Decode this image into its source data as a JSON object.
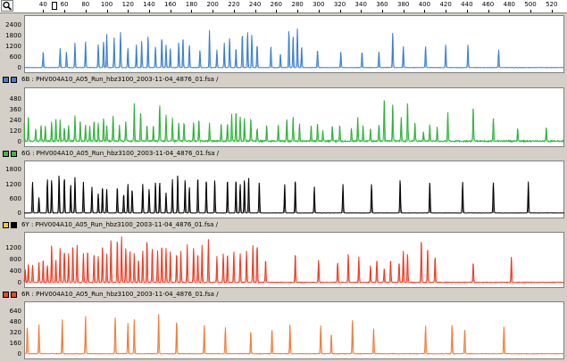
{
  "ruler": {
    "ticks": [
      "40",
      "60",
      "80",
      "100",
      "120",
      "140",
      "160",
      "180",
      "200",
      "220",
      "240",
      "260",
      "280",
      "300",
      "320",
      "340",
      "360",
      "380",
      "400",
      "420",
      "440",
      "460",
      "480",
      "500",
      "520"
    ],
    "x_range": [
      22,
      532
    ]
  },
  "panels": [
    {
      "name": "blue",
      "color": "#3a7fd0",
      "header_label": "",
      "header_squares": [],
      "y_labels": [
        "2400",
        "1800",
        "1200",
        "600",
        "0"
      ],
      "ymax": 2700,
      "noise": 20,
      "peaks": [
        [
          40,
          900
        ],
        [
          56,
          1100
        ],
        [
          62,
          900
        ],
        [
          70,
          1400
        ],
        [
          80,
          1500
        ],
        [
          92,
          1300
        ],
        [
          97,
          1500
        ],
        [
          100,
          1900
        ],
        [
          107,
          1700
        ],
        [
          113,
          2000
        ],
        [
          120,
          1100
        ],
        [
          128,
          1300
        ],
        [
          133,
          1500
        ],
        [
          139,
          1800
        ],
        [
          146,
          1200
        ],
        [
          152,
          1700
        ],
        [
          156,
          1300
        ],
        [
          160,
          1100
        ],
        [
          168,
          1400
        ],
        [
          172,
          1700
        ],
        [
          178,
          1300
        ],
        [
          188,
          1000
        ],
        [
          197,
          2100
        ],
        [
          204,
          1000
        ],
        [
          211,
          1400
        ],
        [
          216,
          1700
        ],
        [
          222,
          1100
        ],
        [
          228,
          1900
        ],
        [
          233,
          2000
        ],
        [
          237,
          1900
        ],
        [
          242,
          1300
        ],
        [
          255,
          1200
        ],
        [
          264,
          800
        ],
        [
          272,
          2100
        ],
        [
          276,
          1800
        ],
        [
          280,
          2200
        ],
        [
          284,
          1200
        ],
        [
          299,
          1000
        ],
        [
          321,
          900
        ],
        [
          341,
          900
        ],
        [
          357,
          900
        ],
        [
          370,
          2000
        ],
        [
          380,
          1200
        ],
        [
          401,
          1200
        ],
        [
          420,
          1300
        ],
        [
          441,
          1300
        ],
        [
          470,
          1000
        ]
      ]
    },
    {
      "name": "green",
      "color": "#2fb33a",
      "header_label": "6B : PHV004A10_A05_Run_hbz3100_2003-11-04_4876_01.fsa /",
      "header_squares": [
        "#4a7fc8",
        "#4a7fc8"
      ],
      "y_labels": [
        "480",
        "360",
        "240",
        "120",
        "0"
      ],
      "ymax": 560,
      "noise": 15,
      "peaks": [
        [
          22,
          210
        ],
        [
          26,
          280
        ],
        [
          33,
          150
        ],
        [
          38,
          190
        ],
        [
          42,
          170
        ],
        [
          48,
          220
        ],
        [
          52,
          260
        ],
        [
          56,
          240
        ],
        [
          60,
          150
        ],
        [
          64,
          180
        ],
        [
          70,
          290
        ],
        [
          75,
          240
        ],
        [
          80,
          190
        ],
        [
          84,
          170
        ],
        [
          88,
          230
        ],
        [
          92,
          200
        ],
        [
          97,
          260
        ],
        [
          100,
          180
        ],
        [
          106,
          290
        ],
        [
          112,
          180
        ],
        [
          118,
          220
        ],
        [
          126,
          420
        ],
        [
          132,
          330
        ],
        [
          138,
          180
        ],
        [
          144,
          180
        ],
        [
          150,
          420
        ],
        [
          156,
          300
        ],
        [
          162,
          260
        ],
        [
          168,
          200
        ],
        [
          173,
          210
        ],
        [
          182,
          210
        ],
        [
          187,
          250
        ],
        [
          197,
          200
        ],
        [
          208,
          200
        ],
        [
          214,
          200
        ],
        [
          218,
          300
        ],
        [
          222,
          340
        ],
        [
          226,
          280
        ],
        [
          230,
          260
        ],
        [
          236,
          260
        ],
        [
          242,
          150
        ],
        [
          251,
          180
        ],
        [
          262,
          190
        ],
        [
          270,
          260
        ],
        [
          276,
          280
        ],
        [
          282,
          200
        ],
        [
          293,
          180
        ],
        [
          299,
          200
        ],
        [
          304,
          120
        ],
        [
          313,
          180
        ],
        [
          320,
          180
        ],
        [
          331,
          150
        ],
        [
          337,
          270
        ],
        [
          342,
          180
        ],
        [
          349,
          150
        ],
        [
          357,
          190
        ],
        [
          362,
          500
        ],
        [
          370,
          420
        ],
        [
          378,
          270
        ],
        [
          384,
          440
        ],
        [
          391,
          210
        ],
        [
          399,
          100
        ],
        [
          405,
          190
        ],
        [
          412,
          160
        ],
        [
          422,
          320
        ],
        [
          446,
          400
        ],
        [
          465,
          270
        ],
        [
          488,
          150
        ],
        [
          515,
          160
        ]
      ]
    },
    {
      "name": "yellow",
      "color": "#000000",
      "header_label": "6G : PHV004A10_A05_Run_hbz3100_2003-11-04_4876_01.fsa /",
      "header_squares": [
        "#3db84a",
        "#3db84a"
      ],
      "y_labels": [
        "1800",
        "1200",
        "600",
        "0"
      ],
      "ymax": 2000,
      "noise": 10,
      "peaks": [
        [
          30,
          1300
        ],
        [
          36,
          650
        ],
        [
          44,
          1400
        ],
        [
          48,
          1400
        ],
        [
          55,
          1600
        ],
        [
          60,
          1500
        ],
        [
          66,
          1200
        ],
        [
          70,
          1500
        ],
        [
          78,
          1300
        ],
        [
          86,
          1100
        ],
        [
          92,
          800
        ],
        [
          96,
          1100
        ],
        [
          100,
          1000
        ],
        [
          110,
          1100
        ],
        [
          116,
          800
        ],
        [
          120,
          1200
        ],
        [
          124,
          1000
        ],
        [
          134,
          1200
        ],
        [
          140,
          1000
        ],
        [
          146,
          1300
        ],
        [
          150,
          1300
        ],
        [
          156,
          850
        ],
        [
          162,
          1400
        ],
        [
          167,
          1600
        ],
        [
          174,
          1400
        ],
        [
          178,
          1100
        ],
        [
          186,
          1500
        ],
        [
          194,
          1400
        ],
        [
          202,
          1400
        ],
        [
          214,
          1400
        ],
        [
          222,
          1400
        ],
        [
          226,
          1200
        ],
        [
          230,
          1400
        ],
        [
          234,
          1500
        ],
        [
          244,
          1300
        ],
        [
          268,
          1200
        ],
        [
          278,
          1400
        ],
        [
          296,
          1100
        ],
        [
          323,
          1200
        ],
        [
          350,
          1200
        ],
        [
          377,
          1400
        ],
        [
          405,
          1300
        ],
        [
          436,
          1300
        ],
        [
          465,
          1300
        ],
        [
          498,
          1300
        ]
      ]
    },
    {
      "name": "red",
      "color": "#ee3b22",
      "header_label": "6Y : PHV004A10_A05_Run_hbz3100_2003-11-04_4876_01.fsa /",
      "header_squares": [
        "#f0d020",
        "#000000"
      ],
      "y_labels": [
        "1200",
        "800",
        "400",
        "0"
      ],
      "ymax": 1600,
      "noise": 20,
      "peaks": [
        [
          23,
          450
        ],
        [
          26,
          650
        ],
        [
          30,
          600
        ],
        [
          36,
          700
        ],
        [
          40,
          800
        ],
        [
          44,
          600
        ],
        [
          48,
          1300
        ],
        [
          52,
          800
        ],
        [
          56,
          1200
        ],
        [
          60,
          1100
        ],
        [
          64,
          1000
        ],
        [
          68,
          1300
        ],
        [
          72,
          1300
        ],
        [
          78,
          1000
        ],
        [
          82,
          1100
        ],
        [
          88,
          1000
        ],
        [
          92,
          900
        ],
        [
          96,
          1300
        ],
        [
          100,
          1000
        ],
        [
          104,
          1500
        ],
        [
          110,
          1500
        ],
        [
          114,
          1600
        ],
        [
          118,
          1200
        ],
        [
          122,
          1100
        ],
        [
          126,
          1000
        ],
        [
          130,
          800
        ],
        [
          134,
          1100
        ],
        [
          138,
          1500
        ],
        [
          143,
          1200
        ],
        [
          148,
          1100
        ],
        [
          152,
          1300
        ],
        [
          156,
          1200
        ],
        [
          160,
          1100
        ],
        [
          166,
          1000
        ],
        [
          170,
          1100
        ],
        [
          176,
          1300
        ],
        [
          182,
          1200
        ],
        [
          186,
          1000
        ],
        [
          190,
          1300
        ],
        [
          196,
          1500
        ],
        [
          204,
          900
        ],
        [
          210,
          1000
        ],
        [
          214,
          1000
        ],
        [
          220,
          1100
        ],
        [
          226,
          1000
        ],
        [
          232,
          1100
        ],
        [
          238,
          1300
        ],
        [
          242,
          1300
        ],
        [
          250,
          800
        ],
        [
          278,
          1000
        ],
        [
          300,
          800
        ],
        [
          318,
          700
        ],
        [
          328,
          1000
        ],
        [
          338,
          900
        ],
        [
          349,
          600
        ],
        [
          355,
          800
        ],
        [
          362,
          500
        ],
        [
          368,
          800
        ],
        [
          376,
          700
        ],
        [
          380,
          1100
        ],
        [
          384,
          1000
        ],
        [
          397,
          1500
        ],
        [
          403,
          1200
        ],
        [
          410,
          900
        ],
        [
          446,
          700
        ],
        [
          482,
          900
        ]
      ]
    },
    {
      "name": "orange",
      "color": "#f07c3a",
      "header_label": "6R : PHV004A10_A05_Run_hbz3100_2003-11-04_4876_01.fsa /",
      "header_squares": [
        "#e84830",
        "#e84830"
      ],
      "y_labels": [
        "640",
        "480",
        "320",
        "160",
        "0"
      ],
      "ymax": 720,
      "noise": 8,
      "peaks": [
        [
          25,
          420
        ],
        [
          36,
          440
        ],
        [
          58,
          520
        ],
        [
          80,
          580
        ],
        [
          108,
          560
        ],
        [
          120,
          460
        ],
        [
          126,
          520
        ],
        [
          149,
          600
        ],
        [
          166,
          500
        ],
        [
          192,
          440
        ],
        [
          212,
          400
        ],
        [
          236,
          350
        ],
        [
          256,
          380
        ],
        [
          273,
          440
        ],
        [
          302,
          420
        ],
        [
          312,
          300
        ],
        [
          332,
          520
        ],
        [
          352,
          380
        ],
        [
          401,
          420
        ],
        [
          426,
          440
        ],
        [
          438,
          380
        ],
        [
          475,
          420
        ]
      ]
    }
  ]
}
